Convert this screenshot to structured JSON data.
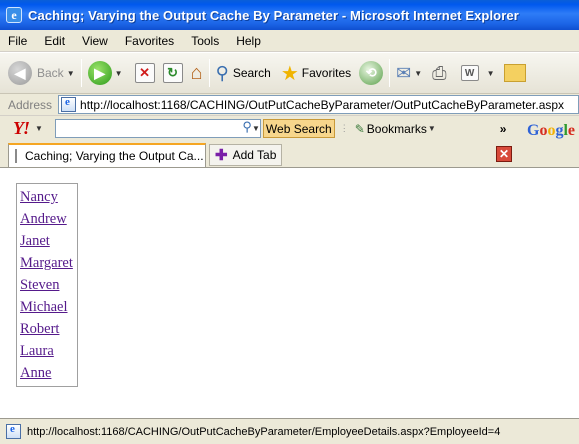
{
  "window": {
    "title": "Caching; Varying the Output Cache By Parameter - Microsoft Internet Explorer"
  },
  "menu": [
    "File",
    "Edit",
    "View",
    "Favorites",
    "Tools",
    "Help"
  ],
  "toolbar": {
    "back_label": "Back",
    "search_label": "Search",
    "favorites_label": "Favorites"
  },
  "address": {
    "label": "Address",
    "url": "http://localhost:1168/CACHING/OutPutCacheByParameter/OutPutCacheByParameter.aspx"
  },
  "yahoo_toolbar": {
    "logo": "Y!",
    "search_value": "",
    "web_search_label": "Web Search",
    "bookmarks_label": "Bookmarks",
    "more": "»",
    "google_logo": [
      "G",
      "o",
      "o",
      "g",
      "l",
      "e"
    ]
  },
  "tabs": {
    "active_title": "Caching; Varying the Output Ca...",
    "add_tab_label": "Add Tab",
    "close_symbol": "✕"
  },
  "employees": [
    "Nancy",
    "Andrew",
    "Janet",
    "Margaret",
    "Steven",
    "Michael",
    "Robert",
    "Laura",
    "Anne"
  ],
  "status": {
    "text": "http://localhost:1168/CACHING/OutPutCacheByParameter/EmployeeDetails.aspx?EmployeeId=4"
  },
  "colors": {
    "titlebar": "#0058ee",
    "visited_link": "#551a8b",
    "web_search_bg": "#f7d68c"
  }
}
